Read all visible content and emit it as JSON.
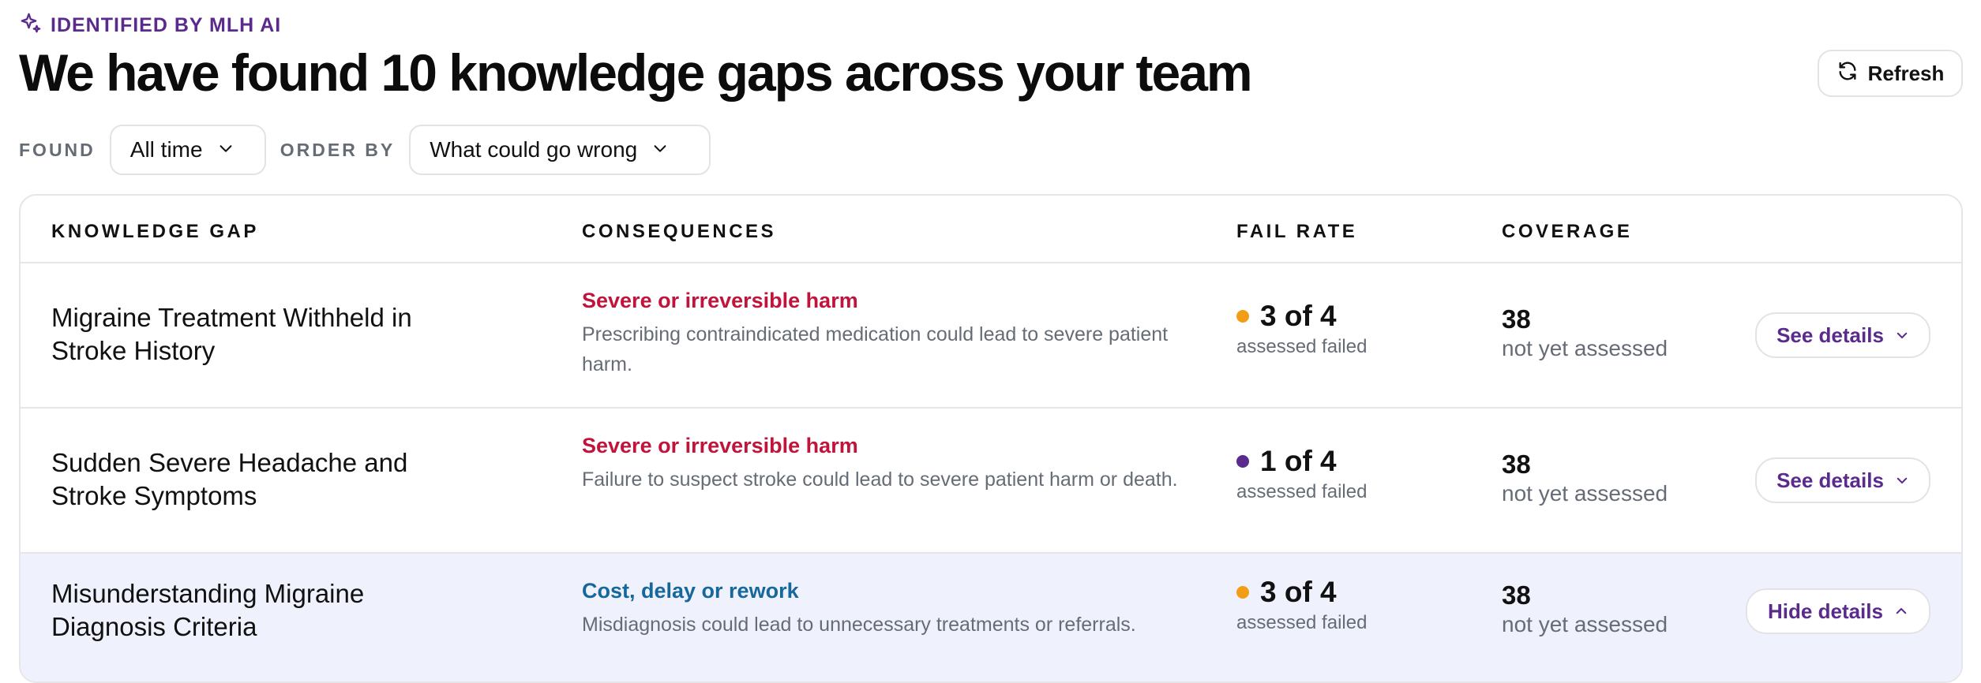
{
  "header": {
    "badge": "IDENTIFIED BY MLH AI",
    "title": "We have found 10 knowledge gaps across your team",
    "refresh_label": "Refresh"
  },
  "filters": {
    "found_label": "FOUND",
    "found_value": "All time",
    "order_label": "ORDER BY",
    "order_value": "What could go wrong"
  },
  "table": {
    "columns": [
      "KNOWLEDGE GAP",
      "CONSEQUENCES",
      "FAIL RATE",
      "COVERAGE"
    ],
    "rows": [
      {
        "gap": "Migraine Treatment Withheld in Stroke History",
        "category": "Severe or irreversible harm",
        "description": "Prescribing contraindicated medication could lead to severe patient harm.",
        "fail_rate": "3 of 4",
        "fail_sub": "assessed failed",
        "coverage": "38",
        "coverage_sub": "not yet assessed",
        "action": "See details"
      },
      {
        "gap": "Sudden Severe Headache and Stroke Symptoms",
        "category": "Severe or irreversible harm",
        "description": "Failure to suspect stroke could lead to severe patient harm or death.",
        "fail_rate": "1 of 4",
        "fail_sub": "assessed failed",
        "coverage": "38",
        "coverage_sub": "not yet assessed",
        "action": "See details"
      },
      {
        "gap": "Misunderstanding Migraine Diagnosis Criteria",
        "category": "Cost, delay or rework",
        "description": "Misdiagnosis could lead to unnecessary treatments or referrals.",
        "fail_rate": "3 of 4",
        "fail_sub": "assessed failed",
        "coverage": "38",
        "coverage_sub": "not yet assessed",
        "action": "Hide details"
      }
    ]
  },
  "colors": {
    "brand_purple": "#5a2a8c",
    "harm_red": "#c0143c",
    "cost_blue": "#17689a",
    "dot_orange": "#f29d16",
    "dot_purple": "#5a2a8c",
    "selected_row_bg": "#eff1fd"
  },
  "icons": {
    "badge": "sparkle-icon",
    "refresh": "refresh-icon",
    "dropdown": "chevron-down-icon",
    "collapse": "chevron-up-icon"
  }
}
